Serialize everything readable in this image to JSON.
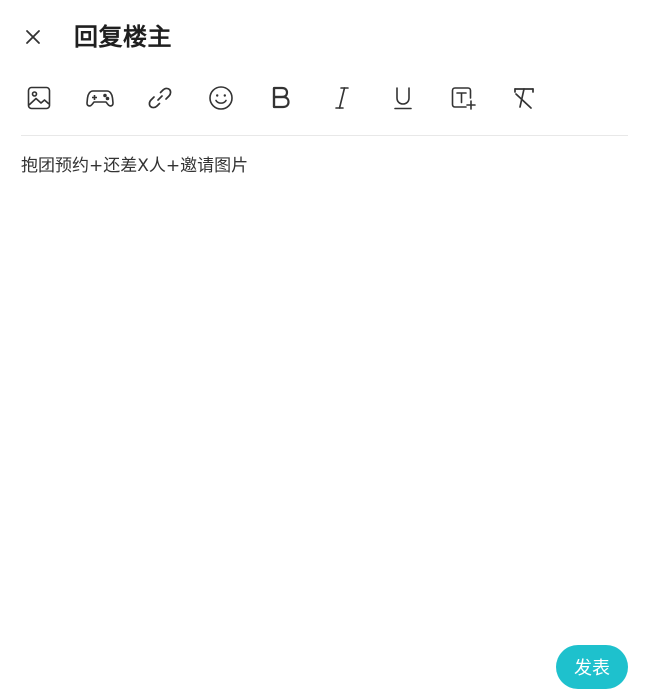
{
  "header": {
    "title": "回复楼主"
  },
  "toolbar": {
    "items": [
      {
        "icon": "image-icon"
      },
      {
        "icon": "gamepad-icon"
      },
      {
        "icon": "link-icon"
      },
      {
        "icon": "emoji-icon"
      },
      {
        "icon": "bold-icon"
      },
      {
        "icon": "italic-icon"
      },
      {
        "icon": "underline-icon"
      },
      {
        "icon": "text-size-icon"
      },
      {
        "icon": "clear-format-icon"
      }
    ]
  },
  "editor": {
    "placeholder": "抱团预约+还差X人+邀请图片"
  },
  "actions": {
    "publish_label": "发表"
  },
  "colors": {
    "accent": "#1ec1cd",
    "text": "#333333",
    "divider": "#e8e8e8"
  }
}
